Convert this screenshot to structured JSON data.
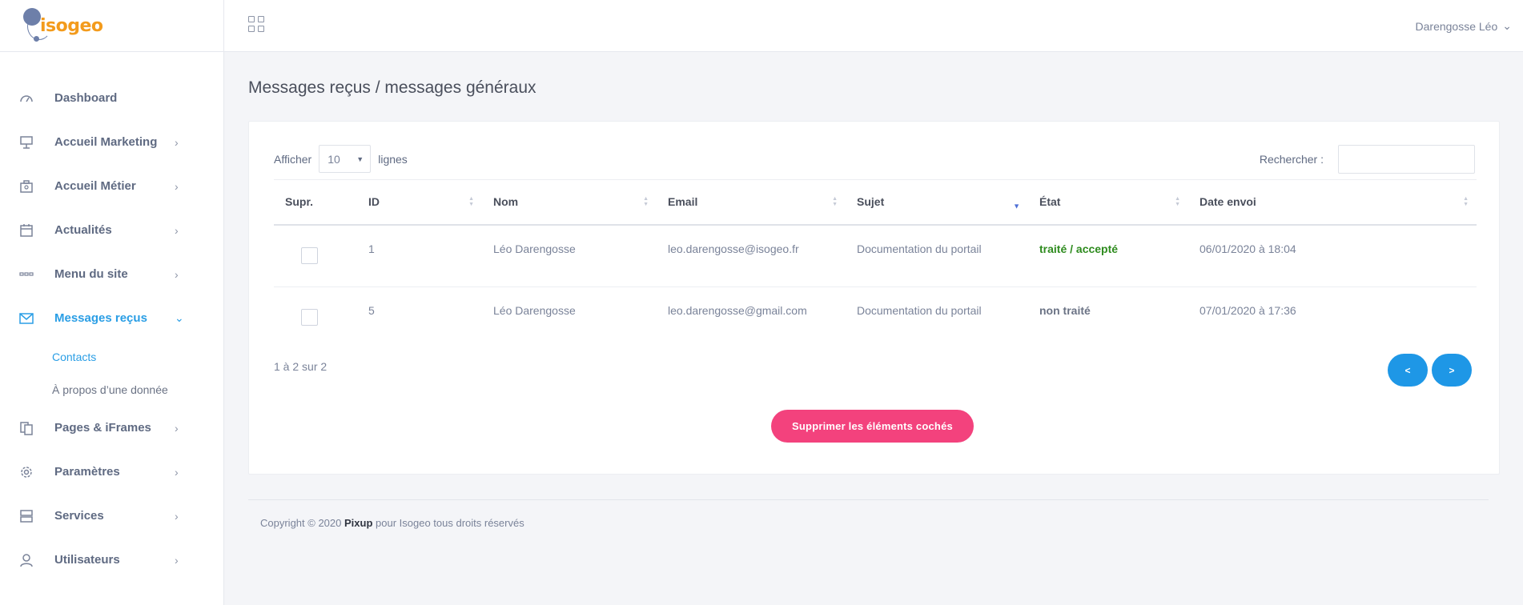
{
  "brand": {
    "logo_text": "isogeo"
  },
  "sidebar": {
    "items": [
      {
        "label": "Dashboard",
        "icon": "dashboard-icon",
        "has_children": false
      },
      {
        "label": "Accueil Marketing",
        "icon": "presentation-icon",
        "has_children": true
      },
      {
        "label": "Accueil Métier",
        "icon": "briefcase-icon",
        "has_children": true
      },
      {
        "label": "Actualités",
        "icon": "calendar-icon",
        "has_children": true
      },
      {
        "label": "Menu du site",
        "icon": "menu-dots-icon",
        "has_children": true
      },
      {
        "label": "Messages reçus",
        "icon": "envelope-icon",
        "has_children": true,
        "active": true
      },
      {
        "label": "Pages & iFrames",
        "icon": "pages-icon",
        "has_children": true
      },
      {
        "label": "Paramètres",
        "icon": "gear-icon",
        "has_children": true
      },
      {
        "label": "Services",
        "icon": "server-icon",
        "has_children": true
      },
      {
        "label": "Utilisateurs",
        "icon": "user-icon",
        "has_children": true
      }
    ],
    "subitems": [
      {
        "label": "Contacts",
        "active": true
      },
      {
        "label": "À propos d’une donnée",
        "active": false
      }
    ]
  },
  "topbar": {
    "user_name": "Darengosse Léo"
  },
  "page": {
    "title": "Messages reçus / messages généraux"
  },
  "table_controls": {
    "show_label": "Afficher",
    "page_size": "10",
    "lines_label": "lignes",
    "search_label": "Rechercher :",
    "search_value": ""
  },
  "table": {
    "columns": [
      "Supr.",
      "ID",
      "Nom",
      "Email",
      "Sujet",
      "État",
      "Date envoi"
    ],
    "rows": [
      {
        "id": "1",
        "nom": "Léo Darengosse",
        "email": "leo.darengosse@isogeo.fr",
        "sujet": "Documentation du portail",
        "etat": "traité / accepté",
        "etat_status": "ok",
        "date": "06/01/2020 à 18:04"
      },
      {
        "id": "5",
        "nom": "Léo Darengosse",
        "email": "leo.darengosse@gmail.com",
        "sujet": "Documentation du portail",
        "etat": "non traité",
        "etat_status": "no",
        "date": "07/01/2020 à 17:36"
      }
    ]
  },
  "pagination": {
    "info": "1 à 2 sur 2",
    "prev_label": "<",
    "next_label": ">"
  },
  "actions": {
    "delete_label": "Supprimer les éléments cochés"
  },
  "footer": {
    "prefix": "Copyright © 2020",
    "brand": "Pixup",
    "suffix": "pour Isogeo tous droits réservés"
  },
  "colors": {
    "accent": "#1e97e6",
    "danger": "#f3427d",
    "success": "#2e8b1e",
    "logo_orange": "#f39b1c",
    "logo_blue": "#6d7fa9"
  }
}
